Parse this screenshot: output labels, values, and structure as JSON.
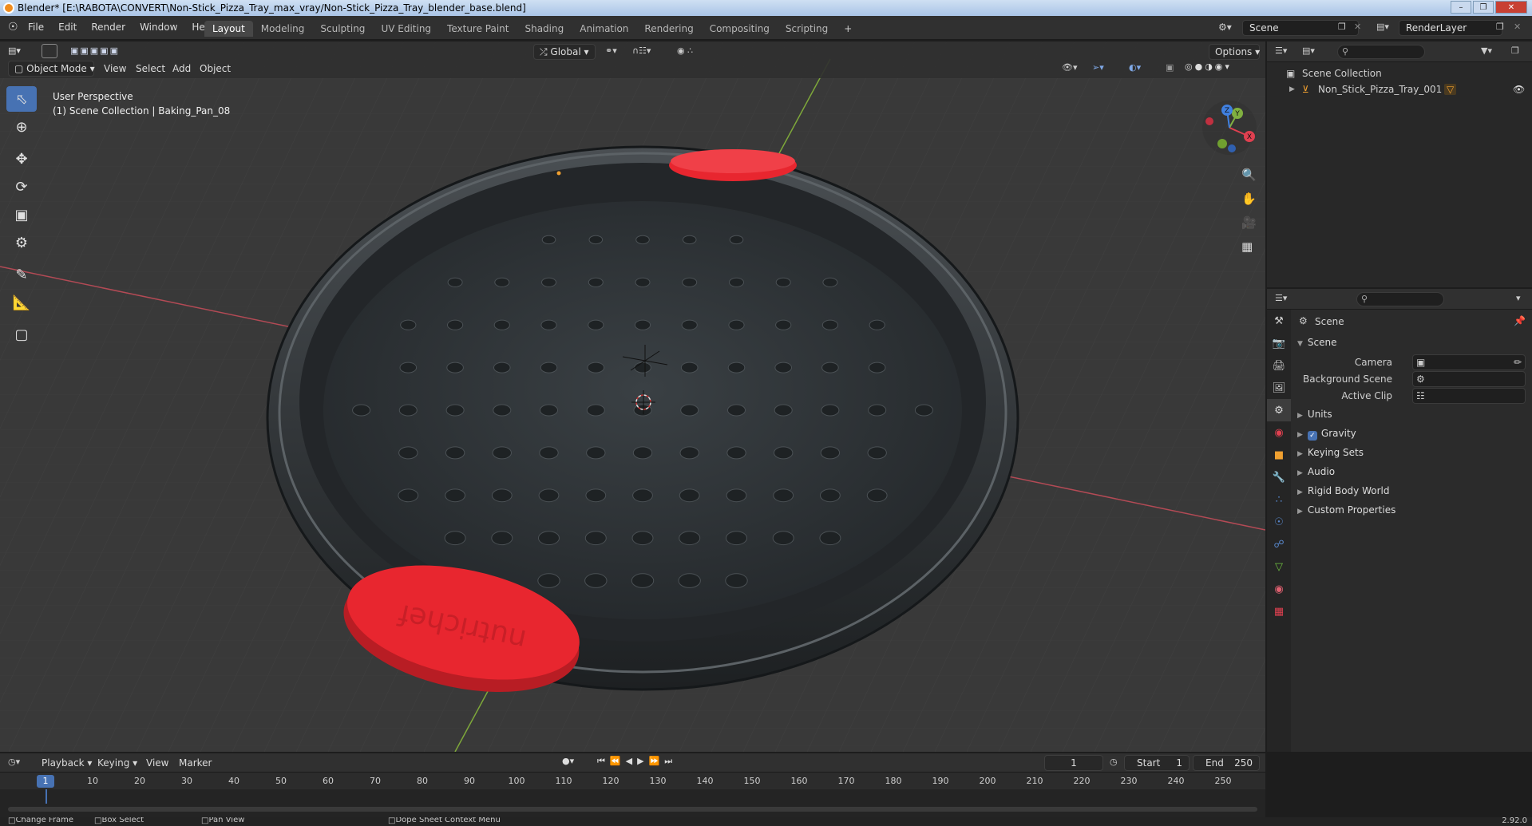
{
  "window": {
    "title": "Blender* [E:\\RABOTA\\CONVERT\\Non-Stick_Pizza_Tray_max_vray/Non-Stick_Pizza_Tray_blender_base.blend]"
  },
  "menu": [
    "File",
    "Edit",
    "Render",
    "Window",
    "Help"
  ],
  "workspaces": [
    "Layout",
    "Modeling",
    "Sculpting",
    "UV Editing",
    "Texture Paint",
    "Shading",
    "Animation",
    "Rendering",
    "Compositing",
    "Scripting"
  ],
  "active_workspace": "Layout",
  "scene_name": "Scene",
  "render_layer": "RenderLayer",
  "viewport": {
    "mode": "Object Mode",
    "menus": [
      "View",
      "Select",
      "Add",
      "Object"
    ],
    "orientation": "Global",
    "options_label": "Options",
    "perspective": "User Perspective",
    "collection_info": "(1) Scene Collection | Baking_Pan_08",
    "gizmo_axes": {
      "x": "X",
      "y": "Y",
      "z": "Z"
    },
    "handle_text": "nutrichef"
  },
  "outliner": {
    "root": "Scene Collection",
    "items": [
      "Non_Stick_Pizza_Tray_001"
    ]
  },
  "properties": {
    "breadcrumb": "Scene",
    "panel_title": "Scene",
    "fields": [
      {
        "label": "Camera"
      },
      {
        "label": "Background Scene"
      },
      {
        "label": "Active Clip"
      }
    ],
    "sections": [
      "Units",
      "Gravity",
      "Keying Sets",
      "Audio",
      "Rigid Body World",
      "Custom Properties"
    ],
    "gravity_checked": true
  },
  "timeline": {
    "menus": [
      "Playback",
      "Keying",
      "View",
      "Marker"
    ],
    "current_frame": "1",
    "start_label": "Start",
    "start": "1",
    "end_label": "End",
    "end": "250",
    "ticks": [
      "10",
      "20",
      "30",
      "40",
      "50",
      "60",
      "70",
      "80",
      "90",
      "100",
      "110",
      "120",
      "130",
      "140",
      "150",
      "160",
      "170",
      "180",
      "190",
      "200",
      "210",
      "220",
      "230",
      "240",
      "250"
    ]
  },
  "statusbar": {
    "items": [
      "Change Frame",
      "Box Select",
      "Pan View",
      "Dope Sheet Context Menu"
    ],
    "version": "2.92.0"
  },
  "colors": {
    "accent": "#4772b3",
    "handle_red": "#e8262f",
    "pan_dark": "#2f3336",
    "grid_bg": "#393939"
  }
}
